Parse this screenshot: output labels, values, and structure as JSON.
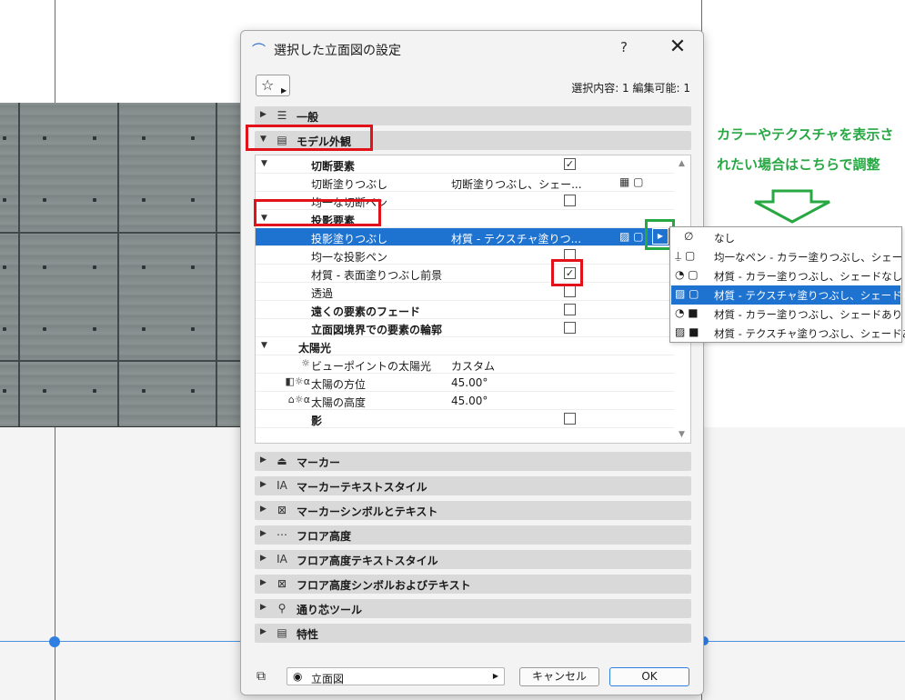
{
  "dialog": {
    "title": "選択した立面図の設定",
    "help": "?",
    "close": "✕",
    "selection_info": "選択内容: 1 編集可能: 1"
  },
  "panels": {
    "general": "一般",
    "model_appearance": "モデル外観",
    "marker": "マーカー",
    "marker_text_style": "マーカーテキストスタイル",
    "marker_symbol_text": "マーカーシンボルとテキスト",
    "floor_level": "フロア高度",
    "floor_level_text_style": "フロア高度テキストスタイル",
    "floor_level_symbol_text": "フロア高度シンボルおよびテキスト",
    "grid_tool": "通り芯ツール",
    "properties": "特性"
  },
  "table": {
    "cut_elements": "切断要素",
    "cut_fill": "切断塗りつぶし",
    "cut_fill_value": "切断塗りつぶし、シェー...",
    "uniform_cut_pen": "均一な切断ペン",
    "projected_elements": "投影要素",
    "projected_fill": "投影塗りつぶし",
    "projected_fill_value": "材質 - テクスチャ塗りつ...",
    "uniform_projected_pen": "均一な投影ペン",
    "surface_fill_foreground": "材質 - 表面塗りつぶし前景",
    "transparency": "透過",
    "distant_fade": "遠くの要素のフェード",
    "boundary_contour": "立面図境界での要素の輪郭",
    "sun": "太陽光",
    "viewpoint_sun": "ビューポイントの太陽光",
    "viewpoint_sun_value": "カスタム",
    "sun_azimuth": "太陽の方位",
    "sun_azimuth_value": "45.00°",
    "sun_altitude": "太陽の高度",
    "sun_altitude_value": "45.00°",
    "shadow": "影"
  },
  "footer": {
    "view_label": "立面図",
    "cancel": "キャンセル",
    "ok": "OK"
  },
  "annotation": {
    "line1": "カラーやテクスチャを表示さ",
    "line2": "れたい場合はこちらで調整"
  },
  "dropdown": {
    "items": [
      "なし",
      "均一なペン - カラー塗りつぶし、シェードなし",
      "材質 - カラー塗りつぶし、シェードなし",
      "材質 - テクスチャ塗りつぶし、シェードなし",
      "材質 - カラー塗りつぶし、シェードあり",
      "材質 - テクスチャ塗りつぶし、シェードあり"
    ],
    "selected_index": 3
  },
  "colors": {
    "accent": "#1e72d0",
    "annotation_red": "#e2121a",
    "annotation_green": "#27a843"
  }
}
